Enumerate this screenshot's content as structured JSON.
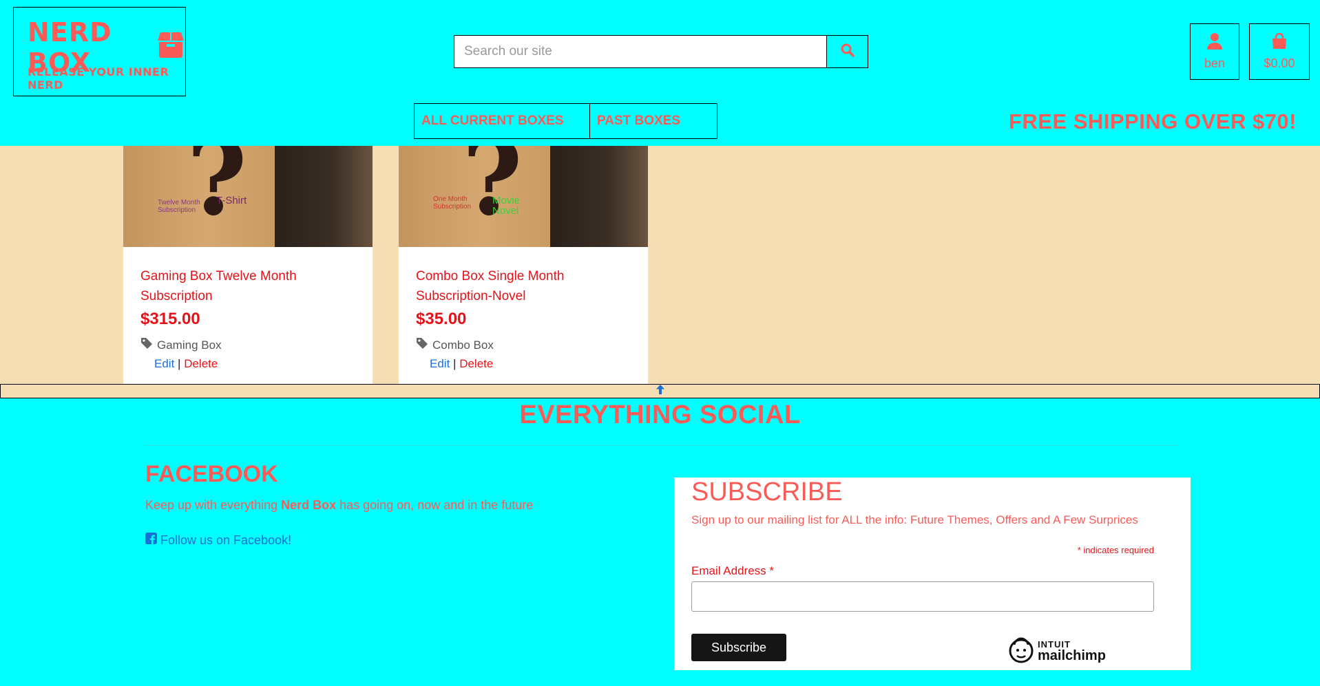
{
  "header": {
    "logo_title": "NERD BOX",
    "logo_tagline": "RELEASE YOUR INNER NERD",
    "search_placeholder": "Search our site",
    "account_label": "ben",
    "cart_total": "$0.00",
    "nav": [
      "ALL CURRENT BOXES",
      "PAST BOXES"
    ],
    "free_shipping": "FREE SHIPPING OVER $70!"
  },
  "products": [
    {
      "title": "Gaming Box Twelve Month Subscription",
      "price": "$315.00",
      "category": "Gaming Box",
      "image_text_small": "Twelve Month Subscription",
      "image_text_large": "T-Shirt",
      "edit": "Edit",
      "separator": "|",
      "delete": "Delete"
    },
    {
      "title": "Combo Box Single Month Subscription-Novel",
      "price": "$35.00",
      "category": "Combo Box",
      "image_text_small": "One Month Subscription",
      "image_text_large": "Movie Novel",
      "edit": "Edit",
      "separator": "|",
      "delete": "Delete"
    }
  ],
  "footer": {
    "social_title": "EVERYTHING SOCIAL",
    "facebook_title": "FACEBOOK",
    "facebook_text_before": "Keep up with everything ",
    "facebook_text_brand": "Nerd Box",
    "facebook_text_after": " has going on, now and in the future",
    "facebook_link": "Follow us on Facebook!"
  },
  "subscribe": {
    "title": "SUBSCRIBE",
    "description": "Sign up to our mailing list for ALL the info: Future Themes, Offers and A Few Surprices",
    "required_star": "*",
    "required_note": " indicates required",
    "email_label": "Email Address ",
    "email_star": "*",
    "button": "Subscribe",
    "mailchimp_line1": "INTUIT",
    "mailchimp_line2": "mailchimp"
  },
  "colors": {
    "background": "#00ffff",
    "accent": "#fa5b57",
    "product_area": "#f5deb3",
    "price_red": "#e4131a",
    "link_blue": "#1a6fd4"
  },
  "icons": [
    "box-icon",
    "search-icon",
    "user-icon",
    "shopping-bag-icon",
    "tag-icon",
    "arrow-up-icon",
    "facebook-icon",
    "mailchimp-icon"
  ]
}
